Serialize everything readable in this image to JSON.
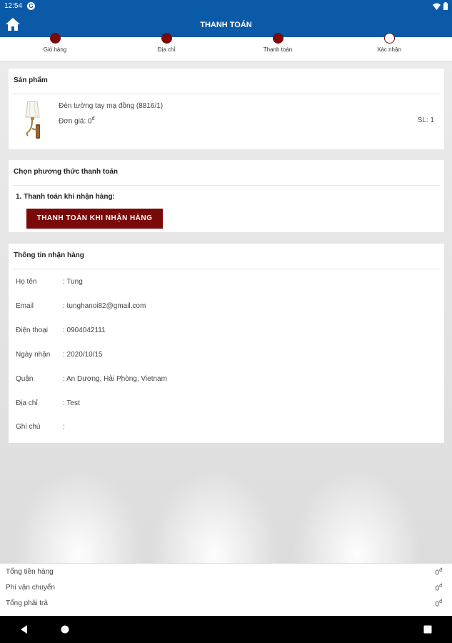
{
  "status_bar": {
    "time": "12:54",
    "g_glyph": "G"
  },
  "app_bar": {
    "title": "THANH TOÁN"
  },
  "steps": [
    {
      "label": "Giỏ hàng",
      "done": true
    },
    {
      "label": "Địa chỉ",
      "done": true
    },
    {
      "label": "Thanh toán",
      "done": true
    },
    {
      "label": "Xác nhận",
      "done": false
    }
  ],
  "product_card": {
    "title": "Sản phẩm",
    "name": "Đèn tường tay mạ đồng (8816/1)",
    "price_label": "Đơn giá: 0",
    "price_unit": "đ",
    "qty": "SL: 1"
  },
  "payment_card": {
    "title": "Chọn phương thức thanh toán",
    "option_label": "1. Thanh toán khi nhận hàng:",
    "option_button": "THANH TOÁN KHI NHẬN HÀNG"
  },
  "delivery_card": {
    "title": "Thông tin nhận hàng",
    "rows": [
      {
        "label": "Họ tên",
        "value": ": Tung"
      },
      {
        "label": "Email",
        "value": ": tunghanoi82@gmail.com"
      },
      {
        "label": "Điện thoại",
        "value": ": 0904042111"
      },
      {
        "label": "Ngày nhận",
        "value": ": 2020/10/15"
      },
      {
        "label": "Quận",
        "value": ": An Dương, Hải Phòng, Vietnam"
      },
      {
        "label": "Địa chỉ",
        "value": ": Test"
      },
      {
        "label": "Ghi chú",
        "value": ":"
      }
    ]
  },
  "totals": [
    {
      "label": "Tổng tiền hàng",
      "value": "0",
      "unit": "đ"
    },
    {
      "label": "Phí vận chuyển",
      "value": "0",
      "unit": "đ"
    },
    {
      "label": "Tổng phải trả",
      "value": "0",
      "unit": "đ"
    }
  ],
  "colors": {
    "primary": "#0a5aa8",
    "accent": "#7a0a0a"
  },
  "icons": [
    "home-icon",
    "back-icon",
    "home-nav-icon",
    "recents-icon",
    "wifi-icon",
    "battery-icon"
  ]
}
